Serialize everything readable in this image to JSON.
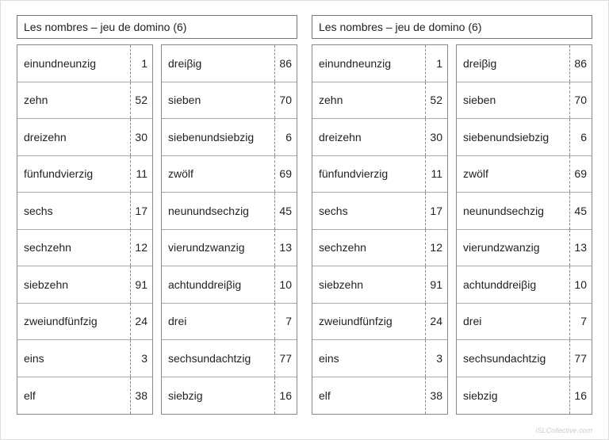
{
  "title": "Les nombres – jeu de domino (6)",
  "watermark": "iSLCollective.com",
  "columns": [
    [
      {
        "word": "einundneunzig",
        "num": "1"
      },
      {
        "word": "zehn",
        "num": "52"
      },
      {
        "word": "dreizehn",
        "num": "30"
      },
      {
        "word": "fünfundvierzig",
        "num": "11"
      },
      {
        "word": "sechs",
        "num": "17"
      },
      {
        "word": "sechzehn",
        "num": "12"
      },
      {
        "word": "siebzehn",
        "num": "91"
      },
      {
        "word": "zweiundfünfzig",
        "num": "24"
      },
      {
        "word": "eins",
        "num": "3"
      },
      {
        "word": "elf",
        "num": "38"
      }
    ],
    [
      {
        "word": "dreiβig",
        "num": "86"
      },
      {
        "word": "sieben",
        "num": "70"
      },
      {
        "word": "siebenundsiebzig",
        "num": "6"
      },
      {
        "word": "zwölf",
        "num": "69"
      },
      {
        "word": "neunundsechzig",
        "num": "45"
      },
      {
        "word": "vierundzwanzig",
        "num": "13"
      },
      {
        "word": "achtunddreiβig",
        "num": "10"
      },
      {
        "word": "drei",
        "num": "7"
      },
      {
        "word": "sechsundachtzig",
        "num": "77"
      },
      {
        "word": "siebzig",
        "num": "16"
      }
    ]
  ]
}
